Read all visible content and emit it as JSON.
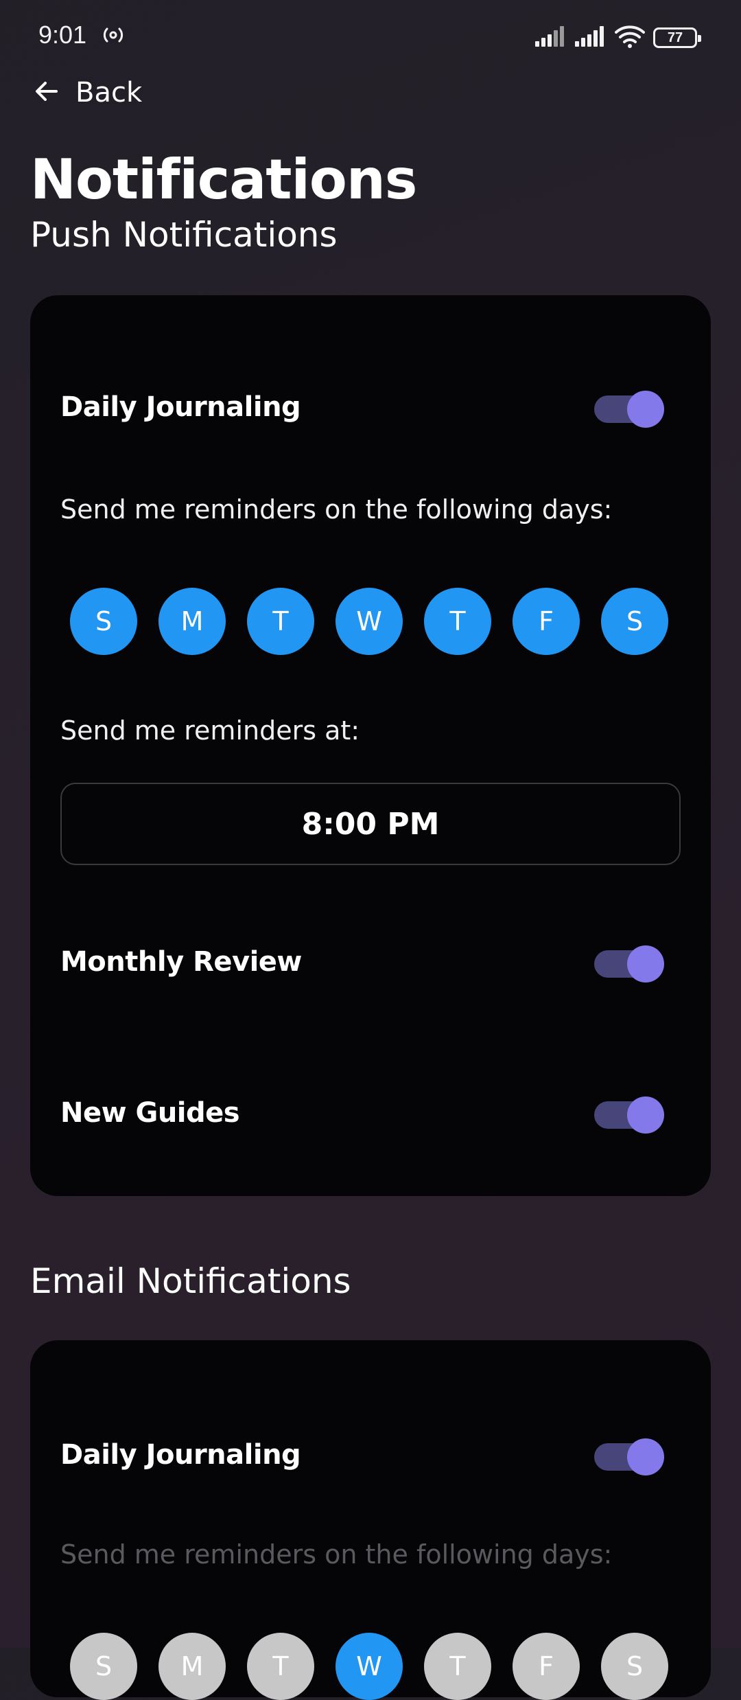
{
  "status_bar": {
    "time": "9:01",
    "battery": "77"
  },
  "nav": {
    "back_label": "Back"
  },
  "page": {
    "title": "Notifications"
  },
  "push": {
    "section_title": "Push Notifications",
    "daily_journaling": {
      "label": "Daily Journaling",
      "enabled": true,
      "days_prompt": "Send me reminders on the following days:",
      "days": [
        {
          "letter": "S",
          "selected": true
        },
        {
          "letter": "M",
          "selected": true
        },
        {
          "letter": "T",
          "selected": true
        },
        {
          "letter": "W",
          "selected": true
        },
        {
          "letter": "T",
          "selected": true
        },
        {
          "letter": "F",
          "selected": true
        },
        {
          "letter": "S",
          "selected": true
        }
      ],
      "time_prompt": "Send me reminders at:",
      "time": "8:00 PM"
    },
    "monthly_review": {
      "label": "Monthly Review",
      "enabled": true
    },
    "new_guides": {
      "label": "New Guides",
      "enabled": true
    }
  },
  "email": {
    "section_title": "Email Notifications",
    "daily_journaling": {
      "label": "Daily Journaling",
      "enabled": true,
      "days_prompt": "Send me reminders on the following days:",
      "days": [
        {
          "letter": "S",
          "selected": false
        },
        {
          "letter": "M",
          "selected": false
        },
        {
          "letter": "T",
          "selected": false
        },
        {
          "letter": "W",
          "selected": true
        },
        {
          "letter": "T",
          "selected": false
        },
        {
          "letter": "F",
          "selected": false
        },
        {
          "letter": "S",
          "selected": false
        }
      ]
    }
  },
  "colors": {
    "accent_toggle_knob": "#8479ea",
    "accent_toggle_track": "#47457a",
    "day_selected": "#2196f3",
    "day_unselected": "#c7c7c7",
    "card_background": "#050507"
  },
  "icons": {
    "back": "arrow-left-icon",
    "radio": "hotspot-icon",
    "signal": "cellular-signal-icon",
    "wifi": "wifi-icon",
    "battery": "battery-icon"
  }
}
